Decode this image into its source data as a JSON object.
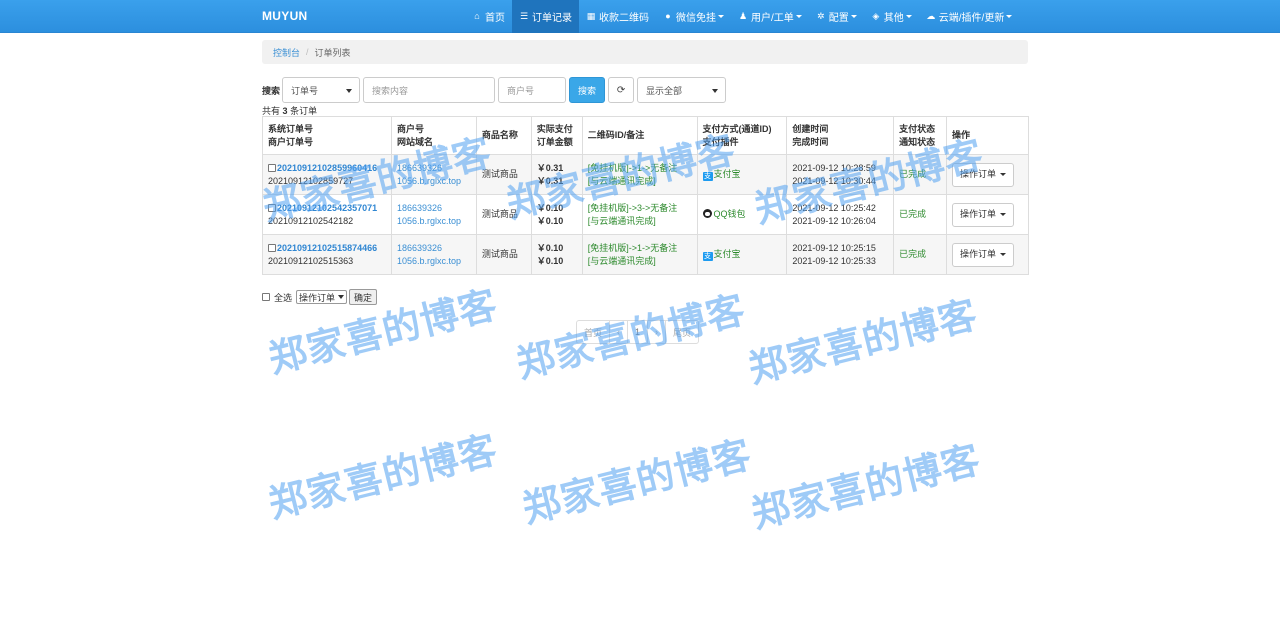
{
  "navbar": {
    "brand": "MUYUN",
    "items": [
      {
        "label": "首页",
        "icon": "home-icon",
        "active": false,
        "dropdown": false
      },
      {
        "label": "订单记录",
        "icon": "list-icon",
        "active": true,
        "dropdown": false
      },
      {
        "label": "收款二维码",
        "icon": "qrcode-icon",
        "active": false,
        "dropdown": false
      },
      {
        "label": "微信免挂",
        "icon": "wechat-icon",
        "active": false,
        "dropdown": true
      },
      {
        "label": "用户/工单",
        "icon": "user-icon",
        "active": false,
        "dropdown": true
      },
      {
        "label": "配置",
        "icon": "gear-icon",
        "active": false,
        "dropdown": true
      },
      {
        "label": "其他",
        "icon": "cube-icon",
        "active": false,
        "dropdown": true
      },
      {
        "label": "云端/插件/更新",
        "icon": "cloud-icon",
        "active": false,
        "dropdown": true
      }
    ]
  },
  "breadcrumb": {
    "home": "控制台",
    "current": "订单列表"
  },
  "search": {
    "label": "搜索",
    "field_select": "订单号",
    "keyword_placeholder": "搜索内容",
    "merchant_placeholder": "商户号",
    "search_button": "搜索",
    "status_select": "显示全部"
  },
  "summary": {
    "prefix": "共有",
    "count": "3",
    "suffix": "条订单"
  },
  "table": {
    "headers": [
      [
        "系统订单号",
        "商户订单号"
      ],
      [
        "商户号",
        "网站域名"
      ],
      [
        "商品名称"
      ],
      [
        "实际支付",
        "订单金额"
      ],
      [
        "二维码ID/备注"
      ],
      [
        "支付方式(通道ID)",
        "支付插件"
      ],
      [
        "创建时间",
        "完成时间"
      ],
      [
        "支付状态",
        "通知状态"
      ],
      [
        "操作"
      ]
    ],
    "rows": [
      {
        "sys_order": "20210912102859960416",
        "merchant_order": "20210912102859727",
        "merchant_id": "186639326",
        "domain": "1056.b.rglxc.top",
        "product": "测试商品",
        "paid": "￥0.31",
        "amount": "￥0.31",
        "qr_line1": "[免挂机版]->1->无备注",
        "qr_line2": "[与云端通讯完成]",
        "pay_method": "支付宝",
        "pay_icon": "alipay-icon",
        "created": "2021-09-12 10:28:59",
        "completed": "2021-09-12 10:30:44",
        "pay_status": "已完成",
        "action": "操作订单"
      },
      {
        "sys_order": "20210912102542357071",
        "merchant_order": "20210912102542182",
        "merchant_id": "186639326",
        "domain": "1056.b.rglxc.top",
        "product": "测试商品",
        "paid": "￥0.10",
        "amount": "￥0.10",
        "qr_line1": "[免挂机版]->3->无备注",
        "qr_line2": "[与云端通讯完成]",
        "pay_method": "QQ钱包",
        "pay_icon": "qq-icon",
        "created": "2021-09-12 10:25:42",
        "completed": "2021-09-12 10:26:04",
        "pay_status": "已完成",
        "action": "操作订单"
      },
      {
        "sys_order": "20210912102515874466",
        "merchant_order": "20210912102515363",
        "merchant_id": "186639326",
        "domain": "1056.b.rglxc.top",
        "product": "测试商品",
        "paid": "￥0.10",
        "amount": "￥0.10",
        "qr_line1": "[免挂机版]->1->无备注",
        "qr_line2": "[与云端通讯完成]",
        "pay_method": "支付宝",
        "pay_icon": "alipay-icon",
        "created": "2021-09-12 10:25:15",
        "completed": "2021-09-12 10:25:33",
        "pay_status": "已完成",
        "action": "操作订单"
      }
    ]
  },
  "bulk": {
    "select_all": "全选",
    "action_select": "操作订单",
    "confirm": "确定"
  },
  "pagination": {
    "first": "首页",
    "prev": "‹",
    "page": "1",
    "next": "›",
    "last": "尾页"
  },
  "watermark": "郑家喜的博客",
  "colors": {
    "navbar": "#2c8fde",
    "link": "#3a8fd4",
    "success": "#2d8a2d",
    "watermark": "#50a0f0"
  }
}
